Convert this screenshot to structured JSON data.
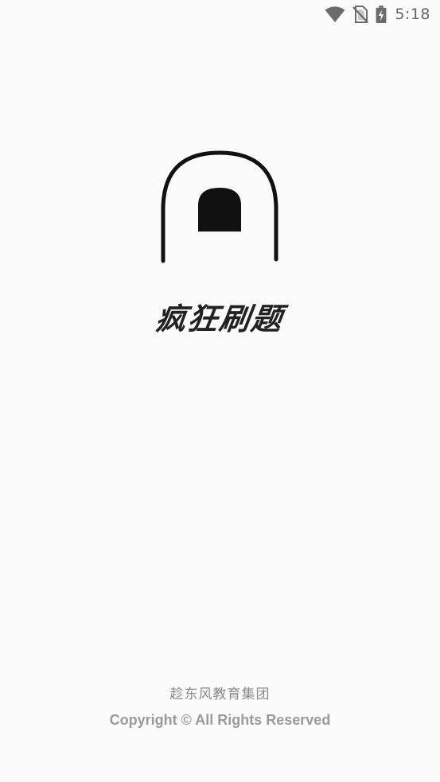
{
  "status_bar": {
    "time": "5:18",
    "icons": [
      "wifi-icon",
      "no-sim-icon",
      "battery-charging-icon"
    ]
  },
  "splash": {
    "logo_icon": "arch-door-logo",
    "app_name": "疯狂刷题"
  },
  "footer": {
    "company": "趁东风教育集团",
    "copyright": "Copyright © All Rights Reserved"
  },
  "colors": {
    "background": "#fafafa",
    "logo": "#111111",
    "footer_text": "#9a9a9a"
  }
}
